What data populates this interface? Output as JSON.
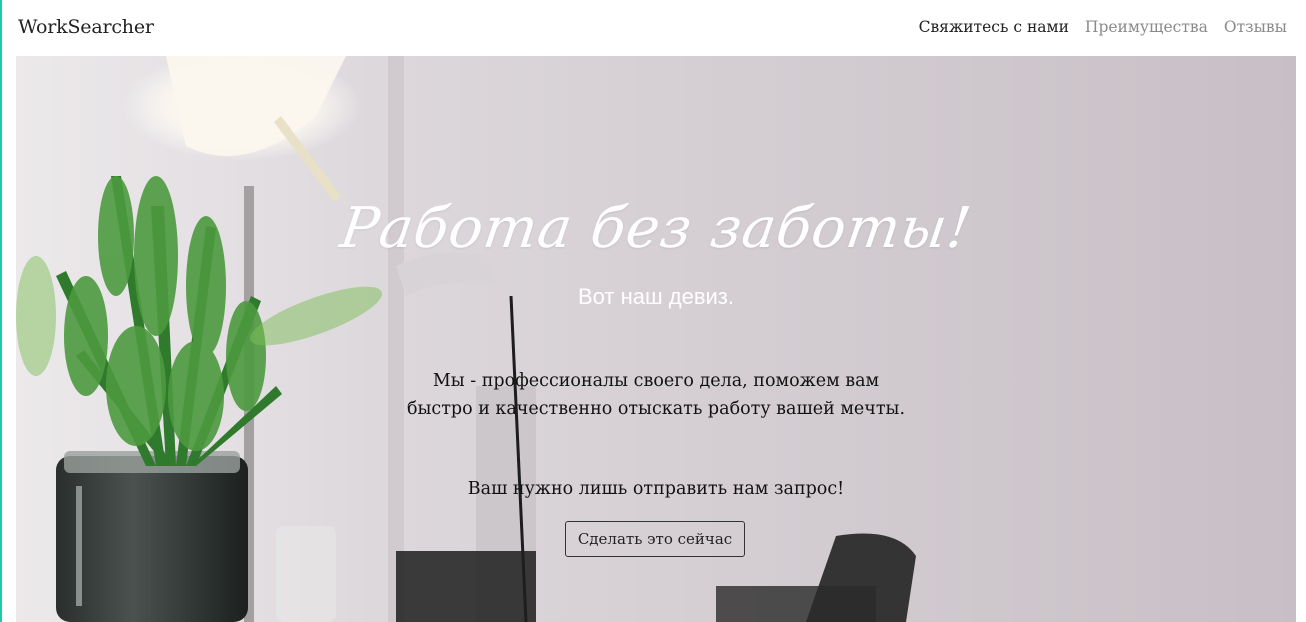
{
  "navbar": {
    "brand": "WorkSearcher",
    "links": [
      {
        "label": "Свяжитесь с нами",
        "active": true
      },
      {
        "label": "Преимущества",
        "active": false
      },
      {
        "label": "Отзывы",
        "active": false
      }
    ]
  },
  "hero": {
    "title": "Работа без заботы!",
    "motto": "Вот наш девиз.",
    "description": "Мы - профессионалы своего дела, поможем вам быстро и качественно отыскать работу вашей мечты.",
    "cta_text": "Ваш нужно лишь отправить нам запрос!",
    "button_label": "Сделать это сейчас"
  },
  "colors": {
    "accent_edge": "#1fc9b0",
    "nav_active": "#222222",
    "nav_inactive": "#8a8a8a"
  }
}
